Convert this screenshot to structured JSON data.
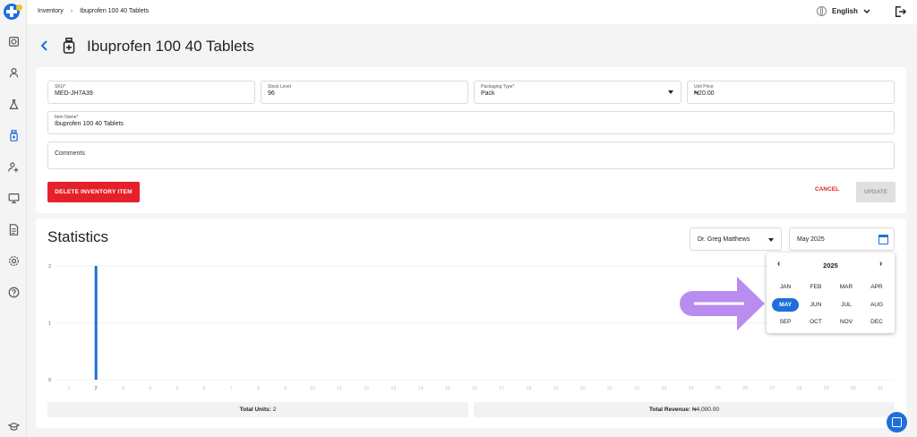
{
  "breadcrumb": {
    "section": "Inventory",
    "separator": "›",
    "current": "Ibuprofen 100 40 Tablets"
  },
  "header": {
    "language": "English"
  },
  "page": {
    "title": "Ibuprofen 100 40 Tablets"
  },
  "form": {
    "sku": {
      "label": "SKU*",
      "value": "MED-JH7A39"
    },
    "stock_level": {
      "label": "Stock Level",
      "value": "96"
    },
    "packaging_type": {
      "label": "Packaging Type*",
      "value": "Pack"
    },
    "unit_price": {
      "label": "Unit Price",
      "value": "₦20.00"
    },
    "item_name": {
      "label": "Item Name*",
      "value": "Ibuprofen 100 40 Tablets"
    },
    "comments": {
      "placeholder": "Comments"
    },
    "delete_label": "DELETE INVENTORY ITEM",
    "cancel_label": "CANCEL",
    "update_label": "UPDATE"
  },
  "statistics": {
    "title": "Statistics",
    "doctor_select": "Dr. Greg Matthews",
    "month_select": "May 2025",
    "total_units_label": "Total Units:",
    "total_units_value": "2",
    "total_revenue_label": "Total Revenue:",
    "total_revenue_value": "₦4,000.00"
  },
  "month_picker": {
    "year": "2025",
    "prev": "‹",
    "next": "›",
    "months": [
      "JAN",
      "FEB",
      "MAR",
      "APR",
      "MAY",
      "JUN",
      "JUL",
      "AUG",
      "SEP",
      "OCT",
      "NOV",
      "DEC"
    ],
    "selected": "MAY"
  },
  "colors": {
    "accent": "#1e6fd9",
    "danger": "#e5202b",
    "arrow": "#b98cf0"
  },
  "chart_data": {
    "type": "bar",
    "x": [
      1,
      2,
      3,
      4,
      5,
      6,
      7,
      8,
      9,
      10,
      11,
      12,
      13,
      14,
      15,
      16,
      17,
      18,
      19,
      20,
      21,
      22,
      23,
      24,
      25,
      26,
      27,
      28,
      29,
      30,
      31
    ],
    "values": [
      0,
      2,
      0,
      0,
      0,
      0,
      0,
      0,
      0,
      0,
      0,
      0,
      0,
      0,
      0,
      0,
      0,
      0,
      0,
      0,
      0,
      0,
      0,
      0,
      0,
      0,
      0,
      0,
      0,
      0,
      0
    ],
    "yticks": [
      0,
      1,
      2
    ],
    "ylim": [
      0,
      2
    ],
    "grid": true,
    "color": "#1e6fd9"
  }
}
